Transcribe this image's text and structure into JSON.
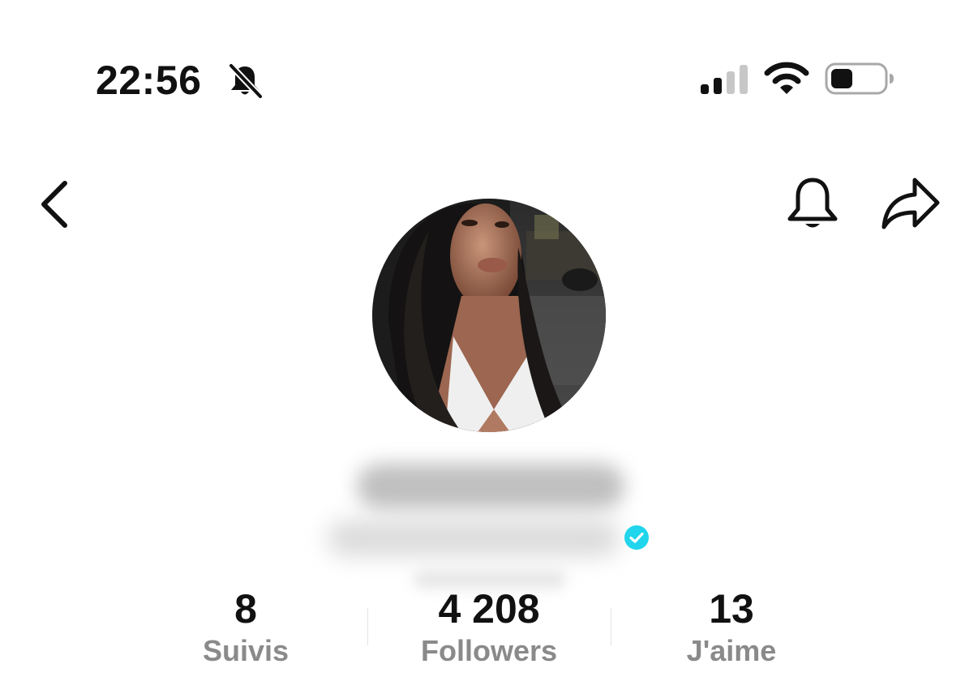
{
  "status_bar": {
    "time": "22:56",
    "icons": {
      "mute": "bell-slash-icon",
      "signal": "cellular-signal-icon",
      "wifi": "wifi-icon",
      "battery": "battery-icon"
    },
    "signal_bars_active": 2,
    "signal_bars_total": 4,
    "battery_level": 0.3
  },
  "nav": {
    "icons": {
      "back": "chevron-left-icon",
      "notifications": "bell-icon",
      "share": "share-arrow-icon"
    }
  },
  "profile": {
    "avatar_icon": "profile-photo",
    "verified_icon": "verified-badge-icon",
    "verified_color": "#20d5ec"
  },
  "stats": [
    {
      "value": "8",
      "label": "Suivis"
    },
    {
      "value": "4 208",
      "label": "Followers"
    },
    {
      "value": "13",
      "label": "J'aime"
    }
  ],
  "colors": {
    "text_primary": "#111111",
    "text_secondary": "#8a8a8a",
    "divider": "#e4e4e4",
    "background": "#ffffff"
  }
}
